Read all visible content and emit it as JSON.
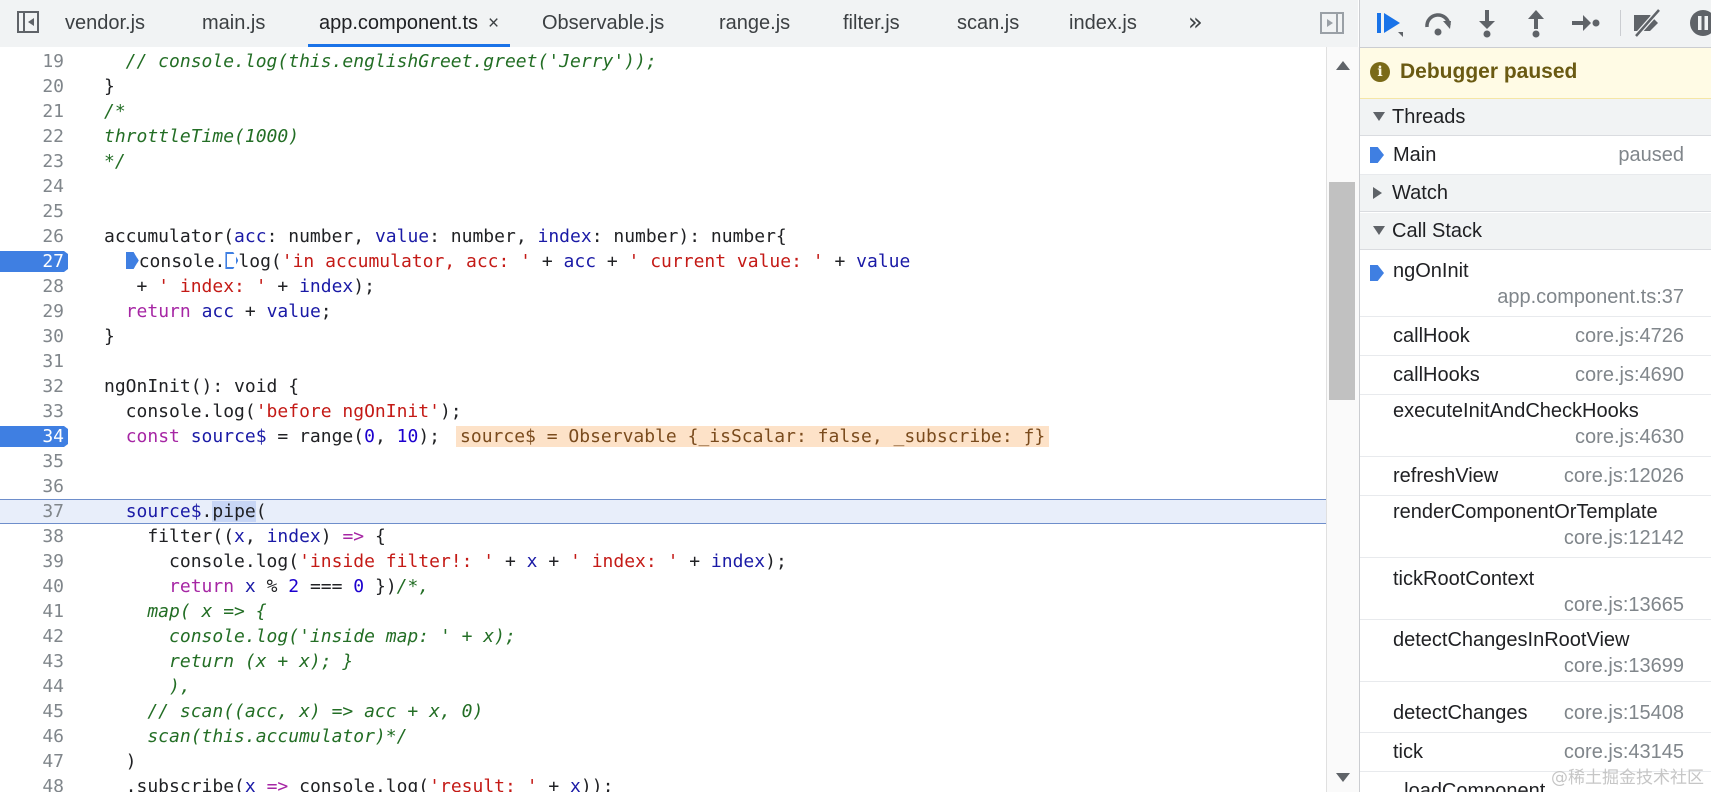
{
  "tabs": [
    "vendor.js",
    "main.js",
    "app.component.ts",
    "Observable.js",
    "range.js",
    "filter.js",
    "scan.js",
    "index.js"
  ],
  "active_tab": "app.component.ts",
  "tab_close": "×",
  "tab_overflow": "»",
  "code_lines": [
    {
      "n": "19"
    },
    {
      "n": "20"
    },
    {
      "n": "21"
    },
    {
      "n": "22"
    },
    {
      "n": "23"
    },
    {
      "n": "24"
    },
    {
      "n": "25"
    },
    {
      "n": "26"
    },
    {
      "n": "27"
    },
    {
      "n": "28"
    },
    {
      "n": "29"
    },
    {
      "n": "30"
    },
    {
      "n": "31"
    },
    {
      "n": "32"
    },
    {
      "n": "33"
    },
    {
      "n": "34"
    },
    {
      "n": "35"
    },
    {
      "n": "36"
    },
    {
      "n": "37"
    },
    {
      "n": "38"
    },
    {
      "n": "39"
    },
    {
      "n": "40"
    },
    {
      "n": "41"
    },
    {
      "n": "42"
    },
    {
      "n": "43"
    },
    {
      "n": "44"
    },
    {
      "n": "45"
    },
    {
      "n": "46"
    },
    {
      "n": "47"
    },
    {
      "n": "48"
    }
  ],
  "breakpoint_lines": [
    "27",
    "34"
  ],
  "current_line": "37",
  "inline_value": "source$ = Observable {_isScalar: false, _subscribe: ƒ}",
  "debugger": {
    "paused_text": "Debugger paused",
    "info_glyph": "i",
    "threads_label": "Threads",
    "thread_name": "Main",
    "thread_status": "paused",
    "watch_label": "Watch",
    "callstack_label": "Call Stack",
    "frames": [
      {
        "fn": "ngOnInit",
        "loc": "app.component.ts:37"
      },
      {
        "fn": "callHook",
        "loc": "core.js:4726"
      },
      {
        "fn": "callHooks",
        "loc": "core.js:4690"
      },
      {
        "fn": "executeInitAndCheckHooks",
        "loc": "core.js:4630"
      },
      {
        "fn": "refreshView",
        "loc": "core.js:12026"
      },
      {
        "fn": "renderComponentOrTemplate",
        "loc": "core.js:12142"
      },
      {
        "fn": "tickRootContext",
        "loc": "core.js:13665"
      },
      {
        "fn": "detectChangesInRootView",
        "loc": "core.js:13699"
      },
      {
        "fn": "detectChanges",
        "loc": "core.js:15408"
      },
      {
        "fn": "tick",
        "loc": "core.js:43145"
      },
      {
        "fn": "_loadComponent",
        "loc": ""
      }
    ]
  },
  "watermark": "@稀土掘金技术社区",
  "colors": {
    "accent": "#1a73e8",
    "breakpoint": "#3f7fe2",
    "paused_bg": "#fffbe5",
    "inline_value_bg": "#fde2c8"
  }
}
